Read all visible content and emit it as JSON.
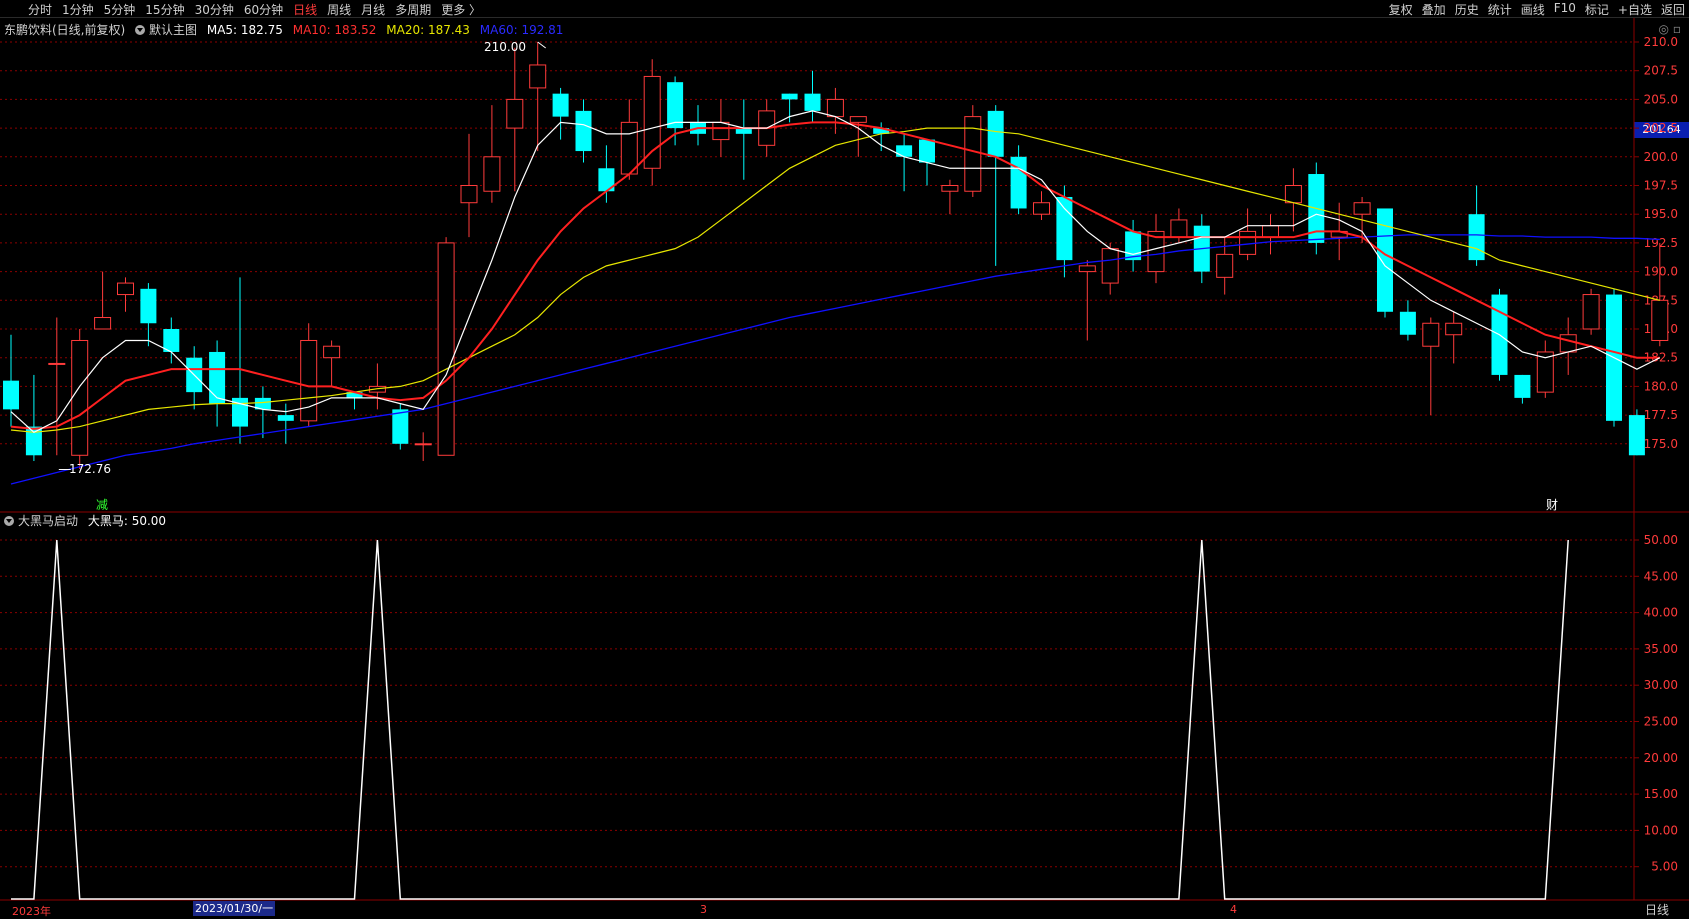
{
  "toolbar": {
    "left_items": [
      "分时",
      "1分钟",
      "5分钟",
      "15分钟",
      "30分钟",
      "60分钟",
      "日线",
      "周线",
      "月线",
      "多周期",
      "更多 〉"
    ],
    "active_index": 6,
    "right_items": [
      "复权",
      "叠加",
      "历史",
      "统计",
      "画线",
      "F10",
      "标记",
      "+自选",
      "返回"
    ]
  },
  "main_legend": {
    "title": "东鹏饮料(日线,前复权)",
    "indicator": "默认主图",
    "ma5": "MA5: 182.75",
    "ma10": "MA10: 183.52",
    "ma20": "MA20: 187.43",
    "ma60": "MA60: 192.81"
  },
  "sub_legend": {
    "indicator": "大黑马启动",
    "value": "大黑马: 50.00"
  },
  "markers": {
    "high_label": "210.00",
    "low_label": "172.76",
    "tag_left": "减",
    "tag_right": "财"
  },
  "price_tag": "201.64",
  "date_axis": {
    "year_label": "2023年",
    "selected_date": "2023/01/30/一",
    "month3": "3",
    "month4": "4",
    "period": "日线"
  },
  "colors": {
    "up": "#ff3b3b",
    "down": "#00ffff",
    "ma5": "#ffffff",
    "ma10": "#ff2020",
    "ma20": "#e6e600",
    "ma60": "#1010ff",
    "grid": "#8b0000",
    "indicator_line": "#ffffff"
  },
  "chart_data": [
    {
      "type": "candlestick",
      "y_ticks": [
        "210.0",
        "207.5",
        "205.0",
        "202.5",
        "200.0",
        "197.5",
        "195.0",
        "192.5",
        "190.0",
        "187.5",
        "185.0",
        "182.5",
        "180.0",
        "177.5",
        "175.0"
      ],
      "ylim": [
        171,
        212
      ],
      "candles": [
        [
          180.5,
          178.0,
          184.5,
          176.5
        ],
        [
          176.5,
          174.0,
          181.0,
          173.5
        ],
        [
          182.0,
          182.0,
          186.0,
          174.0
        ],
        [
          174.0,
          184.0,
          185.0,
          172.8
        ],
        [
          185.0,
          186.0,
          190.0,
          185.0
        ],
        [
          188.0,
          189.0,
          189.5,
          186.5
        ],
        [
          188.5,
          185.5,
          189.0,
          183.5
        ],
        [
          185.0,
          183.0,
          186.0,
          182.0
        ],
        [
          182.5,
          179.5,
          183.5,
          178.0
        ],
        [
          183.0,
          178.5,
          184.0,
          176.5
        ],
        [
          179.0,
          176.5,
          189.5,
          175.0
        ],
        [
          179.0,
          178.0,
          180.0,
          175.5
        ],
        [
          177.5,
          177.0,
          178.5,
          175.0
        ],
        [
          177.0,
          184.0,
          185.5,
          176.5
        ],
        [
          182.5,
          183.5,
          184.0,
          180.0
        ],
        [
          179.5,
          179.0,
          179.5,
          178.0
        ],
        [
          179.5,
          180.0,
          182.0,
          178.0
        ],
        [
          178.0,
          175.0,
          178.5,
          174.5
        ],
        [
          175.0,
          175.0,
          176.0,
          173.5
        ],
        [
          174.0,
          192.5,
          193.0,
          174.0
        ],
        [
          196.0,
          197.5,
          202.0,
          193.0
        ],
        [
          197.0,
          200.0,
          204.5,
          196.0
        ],
        [
          202.5,
          205.0,
          209.5,
          197.0
        ],
        [
          206.0,
          208.0,
          210.0,
          200.5
        ],
        [
          205.5,
          203.5,
          206.0,
          201.5
        ],
        [
          204.0,
          200.5,
          205.0,
          199.5
        ],
        [
          199.0,
          197.0,
          201.0,
          196.0
        ],
        [
          198.5,
          203.0,
          205.0,
          198.0
        ],
        [
          199.0,
          207.0,
          208.5,
          197.5
        ],
        [
          206.5,
          202.5,
          207.0,
          201.0
        ],
        [
          203.0,
          202.0,
          204.5,
          201.0
        ],
        [
          201.5,
          203.0,
          205.0,
          200.0
        ],
        [
          202.5,
          202.0,
          205.0,
          198.0
        ],
        [
          201.0,
          204.0,
          205.0,
          200.0
        ],
        [
          205.5,
          205.0,
          205.5,
          203.0
        ],
        [
          205.5,
          204.0,
          207.5,
          203.0
        ],
        [
          203.5,
          205.0,
          206.0,
          202.0
        ],
        [
          203.0,
          203.5,
          203.5,
          200.0
        ],
        [
          202.5,
          202.0,
          203.0,
          200.5
        ],
        [
          201.0,
          200.0,
          202.0,
          197.0
        ],
        [
          201.5,
          199.5,
          201.5,
          197.5
        ],
        [
          197.0,
          197.5,
          198.0,
          195.0
        ],
        [
          197.0,
          203.5,
          204.5,
          196.5
        ],
        [
          204.0,
          200.0,
          204.5,
          190.5
        ],
        [
          200.0,
          195.5,
          201.0,
          195.0
        ],
        [
          195.0,
          196.0,
          197.0,
          194.5
        ],
        [
          196.5,
          191.0,
          197.5,
          189.5
        ],
        [
          190.0,
          190.5,
          191.0,
          184.0
        ],
        [
          189.0,
          192.0,
          192.5,
          188.0
        ],
        [
          193.5,
          191.0,
          194.5,
          190.0
        ],
        [
          190.0,
          193.5,
          195.0,
          189.0
        ],
        [
          193.0,
          194.5,
          195.5,
          192.5
        ],
        [
          194.0,
          190.0,
          195.0,
          189.0
        ],
        [
          189.5,
          191.5,
          193.0,
          188.0
        ],
        [
          191.5,
          193.5,
          195.5,
          191.0
        ],
        [
          193.0,
          194.0,
          195.0,
          191.5
        ],
        [
          196.0,
          197.5,
          199.0,
          193.5
        ],
        [
          198.5,
          192.5,
          199.5,
          191.5
        ],
        [
          193.0,
          193.5,
          196.0,
          191.0
        ],
        [
          195.0,
          196.0,
          196.5,
          192.5
        ],
        [
          195.5,
          186.5,
          195.5,
          186.0
        ],
        [
          186.5,
          184.5,
          187.5,
          184.0
        ],
        [
          183.5,
          185.5,
          186.0,
          177.5
        ],
        [
          184.5,
          185.5,
          186.5,
          182.0
        ],
        [
          195.0,
          191.0,
          197.5,
          190.5
        ],
        [
          188.0,
          181.0,
          188.5,
          180.5
        ],
        [
          181.0,
          179.0,
          181.0,
          178.5
        ],
        [
          179.5,
          183.0,
          184.0,
          179.0
        ],
        [
          183.0,
          184.5,
          186.0,
          181.0
        ],
        [
          185.0,
          188.0,
          188.5,
          184.5
        ],
        [
          188.0,
          177.0,
          188.5,
          176.5
        ],
        [
          177.5,
          174.0,
          178.0,
          174.0
        ],
        [
          184.0,
          187.5,
          192.5,
          183.5
        ]
      ],
      "ma5": [
        177.8,
        176.0,
        177.0,
        180.0,
        182.5,
        184.0,
        184.0,
        183.0,
        181.0,
        179.0,
        178.5,
        178.0,
        177.8,
        178.2,
        179.0,
        179.0,
        179.0,
        178.5,
        178.0,
        181.0,
        186.0,
        191.0,
        196.5,
        201.0,
        203.0,
        202.8,
        202.0,
        202.0,
        202.5,
        203.0,
        203.0,
        203.0,
        202.5,
        202.5,
        203.5,
        204.0,
        203.5,
        202.5,
        201.0,
        200.0,
        199.5,
        199.0,
        199.0,
        199.0,
        199.0,
        198.0,
        195.5,
        193.5,
        192.0,
        191.5,
        192.0,
        192.5,
        193.0,
        193.0,
        194.0,
        194.0,
        194.0,
        195.0,
        194.5,
        193.5,
        190.5,
        189.0,
        187.5,
        186.5,
        185.5,
        184.5,
        183.0,
        182.5,
        183.0,
        183.5,
        182.5,
        181.5,
        182.5
      ],
      "ma10": [
        176.5,
        176.3,
        176.5,
        177.5,
        179.0,
        180.5,
        181.0,
        181.5,
        181.5,
        181.5,
        181.5,
        181.0,
        180.5,
        180.0,
        180.0,
        179.5,
        179.0,
        178.8,
        179.0,
        180.5,
        182.5,
        185.0,
        188.0,
        191.0,
        193.5,
        195.5,
        197.0,
        198.5,
        200.5,
        202.0,
        202.5,
        202.5,
        202.5,
        202.5,
        202.8,
        203.0,
        203.0,
        202.8,
        202.5,
        202.0,
        201.5,
        201.0,
        200.5,
        200.0,
        199.0,
        197.5,
        196.5,
        195.5,
        194.5,
        193.5,
        193.0,
        193.0,
        193.0,
        193.0,
        193.0,
        193.0,
        193.0,
        193.5,
        193.5,
        193.0,
        191.5,
        190.5,
        189.5,
        188.5,
        187.5,
        186.5,
        185.5,
        184.5,
        184.0,
        183.5,
        183.0,
        182.5,
        182.5
      ],
      "ma20": [
        176.2,
        176.0,
        176.2,
        176.5,
        177.0,
        177.5,
        178.0,
        178.2,
        178.4,
        178.5,
        178.5,
        178.6,
        178.8,
        179.0,
        179.2,
        179.5,
        179.8,
        180.0,
        180.5,
        181.5,
        182.5,
        183.5,
        184.5,
        186.0,
        188.0,
        189.5,
        190.5,
        191.0,
        191.5,
        192.0,
        193.0,
        194.5,
        196.0,
        197.5,
        199.0,
        200.0,
        201.0,
        201.5,
        202.0,
        202.2,
        202.5,
        202.5,
        202.5,
        202.2,
        202.0,
        201.5,
        201.0,
        200.5,
        200.0,
        199.5,
        199.0,
        198.5,
        198.0,
        197.5,
        197.0,
        196.5,
        196.0,
        195.5,
        195.0,
        194.5,
        194.0,
        193.5,
        193.0,
        192.5,
        192.0,
        191.0,
        190.5,
        190.0,
        189.5,
        189.0,
        188.5,
        188.0,
        187.5
      ],
      "ma60": [
        171.5,
        172.0,
        172.5,
        173.0,
        173.5,
        174.0,
        174.3,
        174.6,
        175.0,
        175.3,
        175.6,
        175.9,
        176.2,
        176.5,
        176.8,
        177.1,
        177.4,
        177.7,
        178.0,
        178.5,
        179.0,
        179.5,
        180.0,
        180.5,
        181.0,
        181.5,
        182.0,
        182.5,
        183.0,
        183.5,
        184.0,
        184.5,
        185.0,
        185.5,
        186.0,
        186.4,
        186.8,
        187.2,
        187.6,
        188.0,
        188.4,
        188.8,
        189.2,
        189.6,
        189.9,
        190.2,
        190.5,
        190.8,
        191.0,
        191.3,
        191.5,
        191.8,
        192.0,
        192.2,
        192.4,
        192.6,
        192.7,
        192.8,
        192.9,
        193.0,
        193.1,
        193.2,
        193.2,
        193.2,
        193.2,
        193.1,
        193.1,
        193.0,
        193.0,
        193.0,
        192.9,
        192.9,
        192.8
      ]
    },
    {
      "type": "line",
      "series_name": "大黑马",
      "y_ticks": [
        "50.00",
        "45.00",
        "40.00",
        "35.00",
        "30.00",
        "25.00",
        "20.00",
        "15.00",
        "10.00",
        "5.00"
      ],
      "ylim": [
        0,
        50
      ],
      "values": [
        0,
        0,
        50,
        0,
        0,
        0,
        0,
        0,
        0,
        0,
        0,
        0,
        0,
        0,
        0,
        0,
        50,
        0,
        0,
        0,
        0,
        0,
        0,
        0,
        0,
        0,
        0,
        0,
        0,
        0,
        0,
        0,
        0,
        0,
        0,
        0,
        0,
        0,
        0,
        0,
        0,
        0,
        0,
        0,
        0,
        0,
        0,
        0,
        0,
        0,
        0,
        0,
        50,
        0,
        0,
        0,
        0,
        0,
        0,
        0,
        0,
        0,
        0,
        0,
        0,
        0,
        0,
        0,
        50
      ]
    }
  ]
}
